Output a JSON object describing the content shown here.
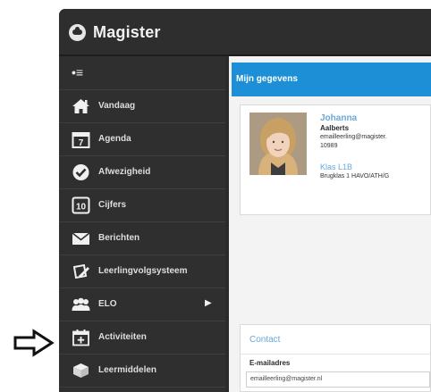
{
  "app": {
    "title": "Magister"
  },
  "sidebar": {
    "items": [
      {
        "label": "Vandaag",
        "icon": "home-icon"
      },
      {
        "label": "Agenda",
        "icon": "calendar-7-icon",
        "icon_text": "7"
      },
      {
        "label": "Afwezigheid",
        "icon": "check-circle-icon"
      },
      {
        "label": "Cijfers",
        "icon": "grade-10-icon",
        "icon_text": "10"
      },
      {
        "label": "Berichten",
        "icon": "envelope-icon"
      },
      {
        "label": "Leerlingvolgsysteem",
        "icon": "notebook-pen-icon"
      },
      {
        "label": "ELO",
        "icon": "people-group-icon",
        "has_submenu": true
      },
      {
        "label": "Activiteiten",
        "icon": "calendar-plus-icon"
      },
      {
        "label": "Leermiddelen",
        "icon": "books-icon"
      }
    ]
  },
  "main": {
    "section_title": "Mijn gegevens",
    "profile": {
      "first_name": "Johanna",
      "last_name": "Aalberts",
      "email": "emailleerling@magister.",
      "number": "10989",
      "class_title": "Klas L1B",
      "class_desc": "Brugklas 1 HAVO/ATH/G"
    },
    "contact": {
      "title": "Contact",
      "email_label": "E-mailadres",
      "email_value": "emailleerling@magister.nl"
    }
  },
  "colors": {
    "accent": "#1c8fd6",
    "link": "#6aa8d8",
    "sidebar_bg": "#2f2f2f"
  }
}
